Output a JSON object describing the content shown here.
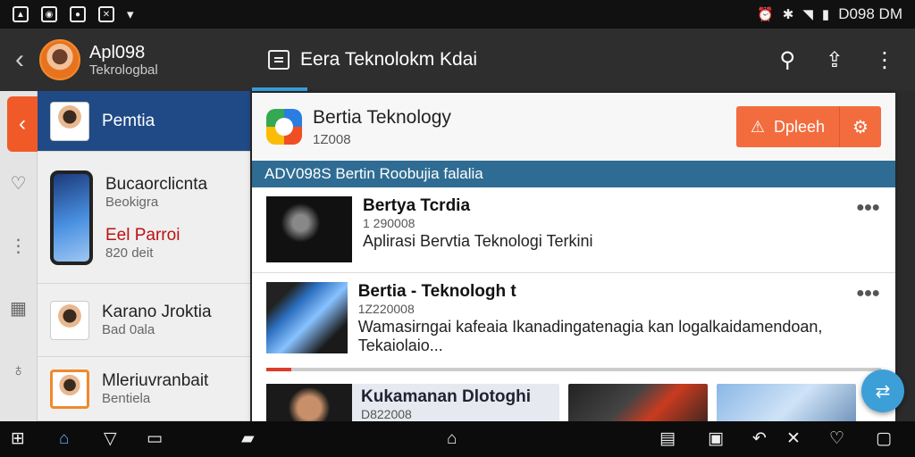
{
  "status_bar": {
    "time": "D098 DM",
    "left_icons": [
      "image-icon",
      "photo-icon",
      "video-icon",
      "share-icon"
    ],
    "right_icons": [
      "alarm-icon",
      "bluetooth-icon",
      "wifi-icon",
      "signal-icon"
    ]
  },
  "app_bar": {
    "profile_name": "Apl098",
    "profile_subtitle": "Tekrologbal",
    "title": "Eera Teknolokm Kdai",
    "actions": [
      "search-icon",
      "share-icon",
      "more-vertical-icon"
    ]
  },
  "sidebar": {
    "items": [
      {
        "title": "Pemtia"
      },
      {
        "title": "Bucaorclicnta",
        "subtitle": "Beokigra",
        "extra_title": "Eel Parroi",
        "extra_subtitle": "820 deit"
      },
      {
        "title": "Karano Jroktia",
        "subtitle": "Bad 0ala"
      },
      {
        "title": "Mleriuvranbait",
        "subtitle": "Bentiela"
      }
    ]
  },
  "main": {
    "app_name": "Bertia Teknology",
    "app_id": "1Z008",
    "update_label": "Dpleeh",
    "banner": "ADV098S Bertin Roobujia falalia",
    "feed": [
      {
        "title": "Bertya  Tcrdia",
        "number": "1 290008",
        "description": "Aplirasi Bervtia Teknologi Terkini"
      },
      {
        "title": "Bertia - Teknologh t",
        "number": "1Z220008",
        "description": "Wamasirngai kafeaia Ikanadingatenagia kan logalkaidamendoan, Tekaiolaio..."
      }
    ],
    "card": {
      "title": "Kukamanan Dlotoghi",
      "subtitle": "D822008"
    },
    "progress": 0.04
  },
  "colors": {
    "accent_orange": "#f36c3d",
    "sidebar_active": "#204a86",
    "banner_blue": "#2f6c93",
    "fab_blue": "#3c9fd8"
  }
}
